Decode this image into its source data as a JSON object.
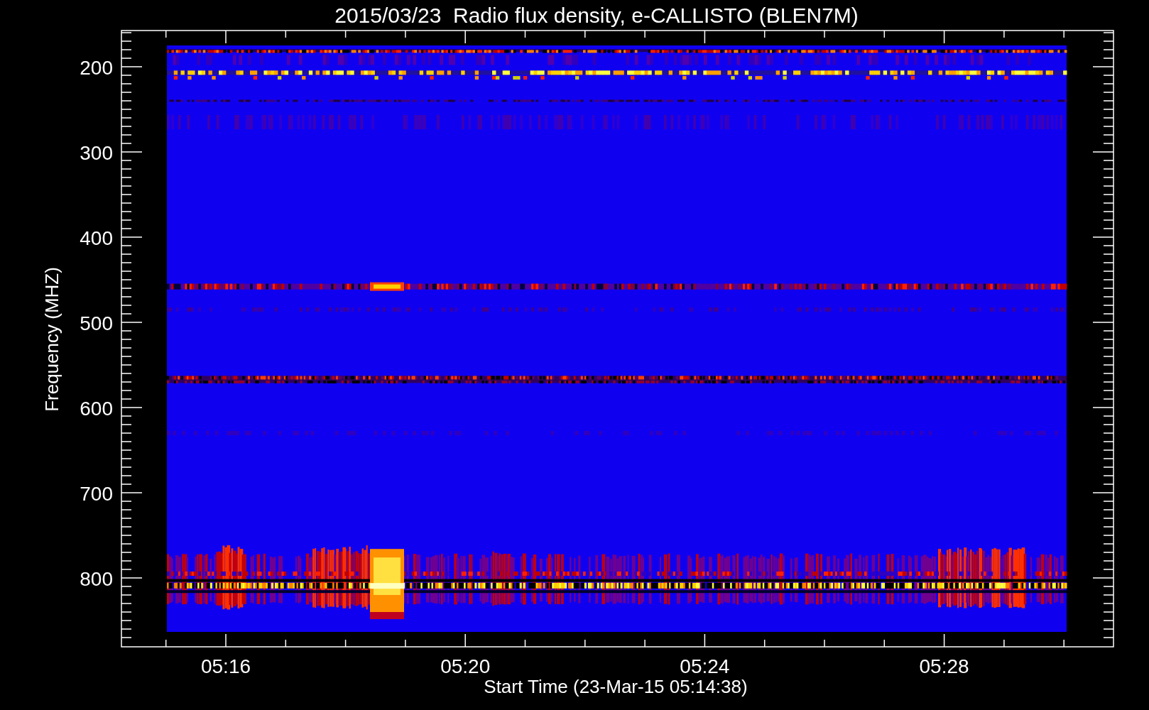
{
  "title": "2015/03/23  Radio flux density, e-CALLISTO (BLEN7M)",
  "y_axis": {
    "label": "Frequency (MHZ)",
    "ticks": [
      "200",
      "300",
      "400",
      "500",
      "600",
      "700",
      "800"
    ]
  },
  "x_axis": {
    "label": "Start Time (23-Mar-15 05:14:38)",
    "ticks": [
      "05:16",
      "05:20",
      "05:24",
      "05:28"
    ]
  }
}
